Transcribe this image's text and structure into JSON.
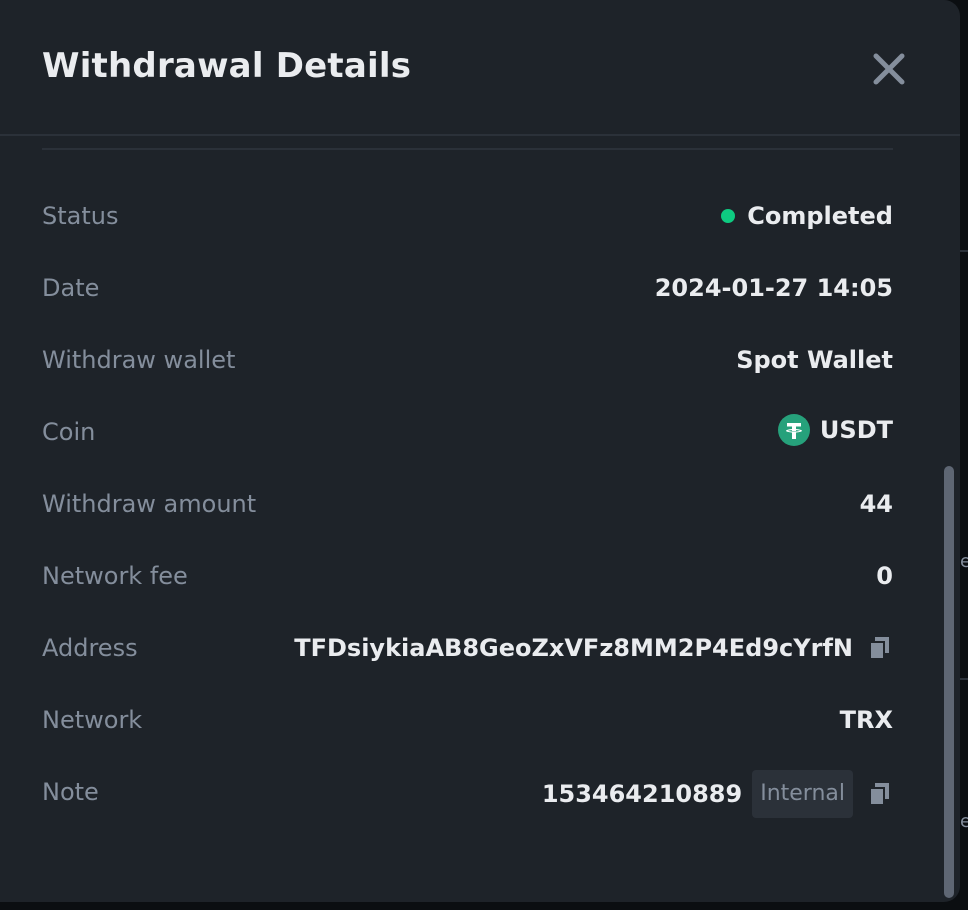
{
  "modal": {
    "title": "Withdrawal Details"
  },
  "details": {
    "status": {
      "label": "Status",
      "value": "Completed"
    },
    "date": {
      "label": "Date",
      "value": "2024-01-27 14:05"
    },
    "wallet": {
      "label": "Withdraw wallet",
      "value": "Spot Wallet"
    },
    "coin": {
      "label": "Coin",
      "value": "USDT",
      "icon": "tether-icon"
    },
    "amount": {
      "label": "Withdraw amount",
      "value": "44"
    },
    "fee": {
      "label": "Network fee",
      "value": "0"
    },
    "address": {
      "label": "Address",
      "value": "TFDsiykiaAB8GeoZxVFz8MM2P4Ed9cYrfN"
    },
    "network": {
      "label": "Network",
      "value": "TRX"
    },
    "note": {
      "label": "Note",
      "value": "153464210889",
      "badge": "Internal"
    }
  },
  "colors": {
    "status_completed": "#0ecb81",
    "tether": "#26a17b",
    "background": "#1e2329",
    "label": "#848e9c",
    "value": "#eaecef"
  }
}
